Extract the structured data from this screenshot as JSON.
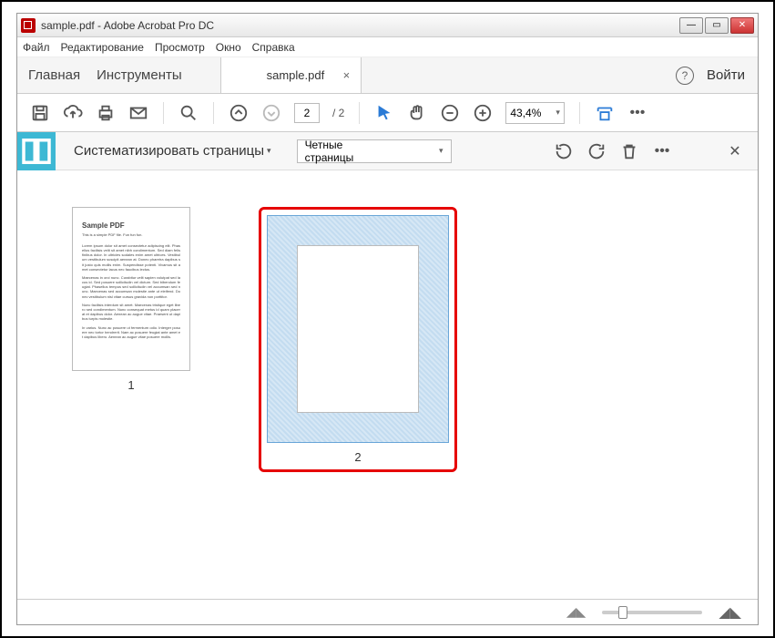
{
  "window": {
    "title": "sample.pdf - Adobe Acrobat Pro DC"
  },
  "menu": {
    "items": [
      "Файл",
      "Редактирование",
      "Просмотр",
      "Окно",
      "Справка"
    ]
  },
  "tabbar": {
    "home": "Главная",
    "tools": "Инструменты",
    "doc_tab": "sample.pdf",
    "login": "Войти"
  },
  "toolbar": {
    "page_current": "2",
    "page_total": "/ 2",
    "zoom": "43,4%"
  },
  "organize": {
    "label": "Систематизировать страницы",
    "filter": "Четные страницы"
  },
  "thumbnails": {
    "page1": {
      "number": "1",
      "title": "Sample PDF",
      "subtitle": "This is a simple PDF file. Fun fun fun."
    },
    "page2": {
      "number": "2"
    }
  }
}
